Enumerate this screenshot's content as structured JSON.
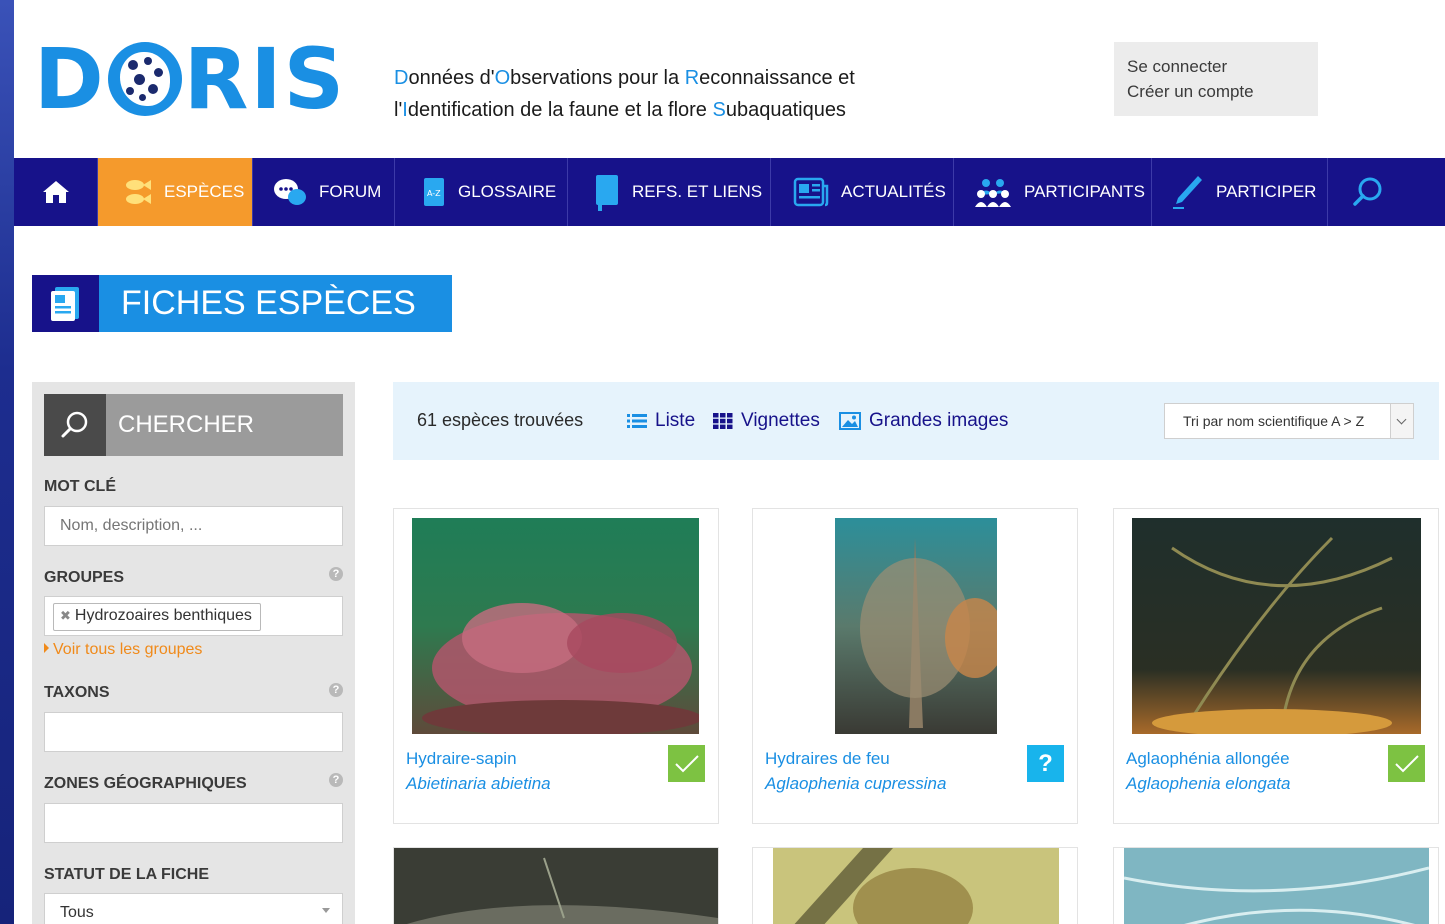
{
  "header": {
    "logo_left": "D",
    "logo_right": "RIS",
    "tagline": [
      [
        {
          "t": "D",
          "h": true
        },
        {
          "t": "onnées d'",
          "h": false
        },
        {
          "t": "O",
          "h": true
        },
        {
          "t": "bservations pour la ",
          "h": false
        },
        {
          "t": "R",
          "h": true
        },
        {
          "t": "econnaissance et",
          "h": false
        }
      ],
      [
        {
          "t": "l'",
          "h": false
        },
        {
          "t": "I",
          "h": true
        },
        {
          "t": "dentification de la faune et la flore ",
          "h": false
        },
        {
          "t": "S",
          "h": true
        },
        {
          "t": "ubaquatiques",
          "h": false
        }
      ]
    ],
    "login": "Se connecter",
    "register": "Créer un compte"
  },
  "nav": {
    "items": [
      {
        "label": "ESPÈCES"
      },
      {
        "label": "FORUM"
      },
      {
        "label": "GLOSSAIRE"
      },
      {
        "label": "REFS. ET LIENS"
      },
      {
        "label": "ACTUALITÉS"
      },
      {
        "label": "PARTICIPANTS"
      },
      {
        "label": "PARTICIPER"
      }
    ]
  },
  "page_title": "FICHES ESPÈCES",
  "sidebar": {
    "search_label": "CHERCHER",
    "keyword_label": "MOT CLÉ",
    "keyword_placeholder": "Nom, description, ...",
    "groups_label": "GROUPES",
    "groups_selected": "Hydrozoaires benthiques",
    "groups_link": "Voir tous les groupes",
    "taxons_label": "TAXONS",
    "zones_label": "ZONES GÉOGRAPHIQUES",
    "status_label": "STATUT DE LA FICHE",
    "status_value": "Tous",
    "help": "?"
  },
  "results": {
    "count": "61 espèces trouvées",
    "view_list": "Liste",
    "view_thumbs": "Vignettes",
    "view_large": "Grandes images",
    "sort": "Tri par nom scientifique A > Z"
  },
  "cards": [
    {
      "common": "Hydraire-sapin",
      "scientific": "Abietinaria abietina",
      "status": "validated"
    },
    {
      "common": "Hydraires de feu",
      "scientific": "Aglaophenia cupressina",
      "status": "question",
      "status_text": "?"
    },
    {
      "common": "Aglaophénia allongée",
      "scientific": "Aglaophenia elongata",
      "status": "validated"
    }
  ],
  "colors": {
    "accent": "#1a8fe3",
    "nav": "#17128a",
    "active": "#f59a2c",
    "link_orange": "#f08a1a",
    "ok": "#7dc242",
    "question": "#18b4ec"
  }
}
